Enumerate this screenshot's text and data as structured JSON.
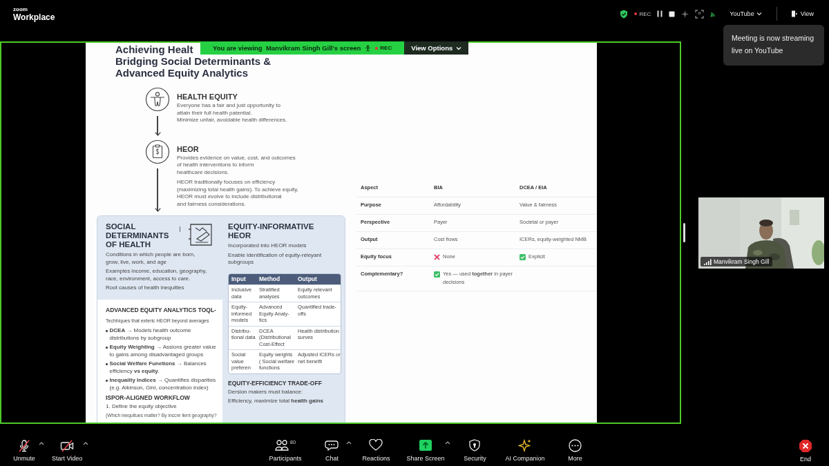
{
  "app": {
    "brand_top": "zoom",
    "brand_bottom": "Workplace"
  },
  "top_bar": {
    "rec_label": "REC",
    "stream_menu": "YouTube",
    "view_button": "View"
  },
  "tooltip": {
    "lines": [
      "Meeting is now streaming",
      "live on YouTube"
    ]
  },
  "share_banner": {
    "text": "You are viewing  Manvikram Singh Gill's screen",
    "rec_label": "REC",
    "button": "View Options"
  },
  "slide": {
    "title_lines": [
      "Achieving Healt",
      "Bridging Social Determinants &",
      "Advanced Equity Analytics"
    ],
    "steps": [
      {
        "kind": "person",
        "heading": "HEALTH EQUITY",
        "paragraphs": [
          [
            "Everyone has a fair and just opportunity to",
            "attain their full health patential.",
            "Minimize unfair, avoidable health differences."
          ]
        ]
      },
      {
        "kind": "clipboard",
        "heading": "HEOR",
        "paragraphs": [
          [
            "Provides evidence on value, cost, and outcomes",
            "of health interventions to inform",
            "healthcare decisions."
          ],
          [
            "HEOR traditionally focuses on efficiency",
            "(maximizing total health gains). To achieve equity,",
            "HEOR must evolve to include distributional",
            "and fairness considerations."
          ]
        ]
      }
    ],
    "sdoh": {
      "heading": [
        "SOCIAL",
        "DETERMINANTS",
        "OF HEALTH"
      ],
      "paragraphs": [
        [
          "Conditions in which people are born,",
          "grow, live, work, and age"
        ],
        [
          "Examples income, education, geography,",
          "race, environment, access to care."
        ],
        [
          "Root causes of health inequities"
        ]
      ]
    },
    "tools": {
      "heading": "ADVANCED EQUITY ANALYTICS TOQL-",
      "intro": "Techhiques that exteric HEOR beyond averages",
      "bullets": [
        [
          "**DCEA** → Models health outcome",
          "distributions by subgroup"
        ],
        [
          "**Equity Weighting** → Assions greater value",
          "to gains among disadvantaged groups"
        ],
        [
          "**Social Welfare Funetions** → Balances",
          "efficiency **vs equity**."
        ],
        [
          "**Inequality Indices** → Quantifies disparities",
          "(e.g. Alkinson, Gini, concentration index)"
        ]
      ]
    },
    "workflow": {
      "heading": "ISPOR-ALIGNED WORKFLOW",
      "steps": [
        {
          "text": "1. Define the equity objective",
          "note": "(Which inequitues matter? By inccre lient geography?"
        }
      ]
    },
    "informative": {
      "heading": [
        "EQUITY-INFORMATIVE",
        "HEOR"
      ],
      "paragraphs": [
        [
          "Incorporated into HEOR models"
        ],
        [
          "Enable identification of equity-releyant",
          "subgroups"
        ]
      ],
      "table": {
        "columns": [
          "Input",
          "Method",
          "Output"
        ],
        "rows": [
          [
            "Inclusive data",
            "Stratified analyses",
            "Equity relevant outcomes"
          ],
          [
            "Equity-informed models",
            "Advanced Equity Analy-tics",
            "Quantified trade-offs"
          ],
          [
            "Distribu-tional data",
            "DCEA (Distributional Cost-Effect",
            "Health distribution surves"
          ],
          [
            "Social value preferen",
            "Equity weights ( Social welfare functions",
            "Adjusted ICERs or net benefit"
          ]
        ]
      }
    },
    "tradeoff": {
      "heading": "EQUITY-EFFICIENCY TRADE-OFF",
      "lines": [
        "Dersion makers must balance:",
        "Efficiency, maximize total **health gains**"
      ]
    },
    "comparison": {
      "columns": [
        "Aspect",
        "BIA",
        "DCEA / EIA"
      ],
      "rows": [
        [
          {
            "kind": "text",
            "text": "Purpose"
          },
          {
            "kind": "text",
            "text": "Affordability"
          },
          {
            "kind": "text",
            "text": "Value & fairness"
          }
        ],
        [
          {
            "kind": "text",
            "text": "Perspective"
          },
          {
            "kind": "text",
            "text": "Payer"
          },
          {
            "kind": "text",
            "text": "Societal or payer"
          }
        ],
        [
          {
            "kind": "text",
            "text": "Output"
          },
          {
            "kind": "text",
            "text": "Cost flows"
          },
          {
            "kind": "text",
            "text": "ICERs, equity-weighted NMB"
          }
        ],
        [
          {
            "kind": "text",
            "text": "Equity focus"
          },
          {
            "kind": "cross",
            "text": "None"
          },
          {
            "kind": "check",
            "text": "Explicit"
          }
        ],
        [
          {
            "kind": "text",
            "text": "Complementary?"
          },
          {
            "kind": "check",
            "text": "Yes — used **together** in payer decisions"
          }
        ]
      ]
    }
  },
  "participant": {
    "name": "Manvikram Singh Gill"
  },
  "toolbar": {
    "left": [
      {
        "kind": "mic",
        "label": "Unmute",
        "off": true,
        "menu": true
      },
      {
        "kind": "video",
        "label": "Start Video",
        "off": true,
        "menu": true
      }
    ],
    "center": [
      {
        "kind": "participants",
        "label": "Participants",
        "badge": "80",
        "off": false,
        "menu": false
      },
      {
        "kind": "chat",
        "label": "Chat",
        "off": false,
        "menu": true
      },
      {
        "kind": "reactions",
        "label": "Reactions",
        "off": false,
        "menu": false
      },
      {
        "kind": "share",
        "label": "Share Screen",
        "off": false,
        "menu": true
      },
      {
        "kind": "security",
        "label": "Security",
        "off": false,
        "menu": false
      },
      {
        "kind": "ai",
        "label": "AI Companion",
        "off": false,
        "menu": false
      },
      {
        "kind": "more",
        "label": "More",
        "off": false,
        "menu": false
      }
    ],
    "end": {
      "label": "End"
    }
  }
}
